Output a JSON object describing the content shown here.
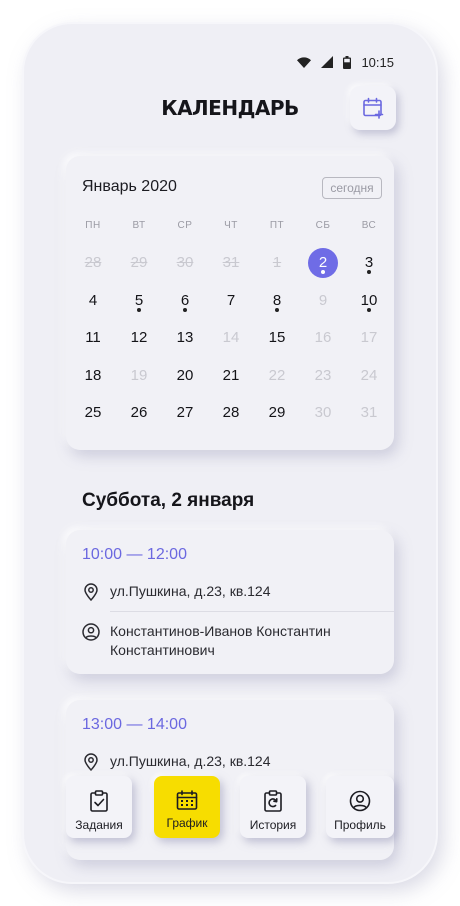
{
  "status": {
    "time": "10:15"
  },
  "header": {
    "title": "КАЛЕНДАРЬ"
  },
  "calendar": {
    "month_label": "Январь 2020",
    "today_button": "сегодня",
    "weekdays": [
      "ПН",
      "ВТ",
      "СР",
      "ЧТ",
      "ПТ",
      "СБ",
      "ВС"
    ],
    "days": [
      {
        "d": "28",
        "state": "struck"
      },
      {
        "d": "29",
        "state": "struck"
      },
      {
        "d": "30",
        "state": "struck"
      },
      {
        "d": "31",
        "state": "struck"
      },
      {
        "d": "1",
        "state": "struck"
      },
      {
        "d": "2",
        "state": "selected",
        "dot": true
      },
      {
        "d": "3",
        "state": "normal",
        "dot": true
      },
      {
        "d": "4",
        "state": "normal"
      },
      {
        "d": "5",
        "state": "normal",
        "dot": true
      },
      {
        "d": "6",
        "state": "normal",
        "dot": true
      },
      {
        "d": "7",
        "state": "normal"
      },
      {
        "d": "8",
        "state": "normal",
        "dot": true
      },
      {
        "d": "9",
        "state": "muted"
      },
      {
        "d": "10",
        "state": "normal",
        "dot": true
      },
      {
        "d": "11",
        "state": "normal"
      },
      {
        "d": "12",
        "state": "normal"
      },
      {
        "d": "13",
        "state": "normal"
      },
      {
        "d": "14",
        "state": "muted"
      },
      {
        "d": "15",
        "state": "normal"
      },
      {
        "d": "16",
        "state": "muted"
      },
      {
        "d": "17",
        "state": "muted"
      },
      {
        "d": "18",
        "state": "normal"
      },
      {
        "d": "19",
        "state": "muted"
      },
      {
        "d": "20",
        "state": "normal"
      },
      {
        "d": "21",
        "state": "normal"
      },
      {
        "d": "22",
        "state": "muted"
      },
      {
        "d": "23",
        "state": "muted"
      },
      {
        "d": "24",
        "state": "muted"
      },
      {
        "d": "25",
        "state": "normal"
      },
      {
        "d": "26",
        "state": "normal"
      },
      {
        "d": "27",
        "state": "normal"
      },
      {
        "d": "28",
        "state": "normal"
      },
      {
        "d": "29",
        "state": "normal"
      },
      {
        "d": "30",
        "state": "muted"
      },
      {
        "d": "31",
        "state": "muted"
      }
    ]
  },
  "schedule": {
    "date_title": "Суббота, 2 января",
    "events": [
      {
        "time": "10:00 — 12:00",
        "address": "ул.Пушкина, д.23, кв.124",
        "client": "Константинов-Иванов Константин Константинович"
      },
      {
        "time": "13:00 — 14:00",
        "address": "ул.Пушкина, д.23, кв.124"
      }
    ]
  },
  "nav": {
    "items": [
      {
        "label": "Задания",
        "icon": "clipboard-check-icon"
      },
      {
        "label": "График",
        "icon": "calendar-icon",
        "active": true
      },
      {
        "label": "История",
        "icon": "clipboard-refresh-icon"
      },
      {
        "label": "Профиль",
        "icon": "user-circle-icon"
      }
    ]
  },
  "colors": {
    "accent": "#6f6ce6",
    "active_nav": "#f7dd00",
    "background": "#efeff5"
  }
}
